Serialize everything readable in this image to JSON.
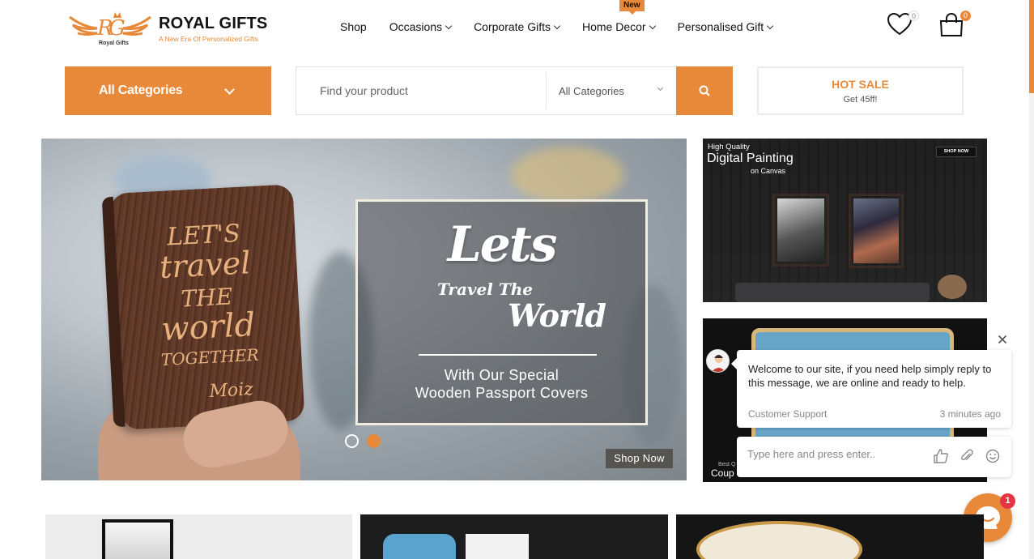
{
  "brand": {
    "name": "ROYAL GIFTS",
    "tagline": "A New Era Of Personalized Gifts",
    "monogram_caption": "Royal Gifts"
  },
  "nav": {
    "items": [
      {
        "label": "Shop",
        "dropdown": false
      },
      {
        "label": "Occasions",
        "dropdown": true
      },
      {
        "label": "Corporate Gifts",
        "dropdown": true
      },
      {
        "label": "Home Decor",
        "dropdown": true,
        "badge": "New"
      },
      {
        "label": "Personalised Gift",
        "dropdown": true
      }
    ]
  },
  "header_icons": {
    "wishlist": {
      "icon": "heart-icon",
      "count": "0"
    },
    "cart": {
      "icon": "shopping-bag-icon",
      "count": "0"
    }
  },
  "search_bar": {
    "all_categories_button": "All Categories",
    "placeholder": "Find your product",
    "category_select": "All Categories",
    "submit_icon": "search-icon"
  },
  "hot_sale": {
    "title": "HOT SALE",
    "subtitle": "Get 45ff!"
  },
  "hero": {
    "headline_line1": "Lets",
    "headline_line2": "Travel The",
    "headline_line3": "World",
    "subtext_line1": "With Our Special",
    "subtext_line2": "Wooden Passport Covers",
    "engraving": {
      "line1": "LET'S",
      "line2": "travel",
      "line3": "THE",
      "line4": "world",
      "line5": "TOGETHER",
      "signature": "Moiz"
    },
    "cta": "Shop Now",
    "slides": 2,
    "active_slide": 2
  },
  "side_banners": {
    "top": {
      "kicker": "High Quality",
      "title": "Digital Painting",
      "subtitle": "on Canvas",
      "button": "SHOP NOW"
    },
    "bottom": {
      "caption_small": "Best Q",
      "caption_large": "Coup"
    }
  },
  "chat": {
    "message": "Welcome to our site, if you need help simply reply to this message, we are online and ready to help.",
    "sender": "Customer Support",
    "time": "3 minutes ago",
    "input_placeholder": "Type here and press enter..",
    "unread_count": "1",
    "icons": [
      "close-icon",
      "thumbs-up-icon",
      "paperclip-icon",
      "emoji-icon",
      "chat-bubble-icon"
    ]
  },
  "colors": {
    "accent": "#e8893a",
    "text": "#111111",
    "chat_badge": "#e53542"
  }
}
